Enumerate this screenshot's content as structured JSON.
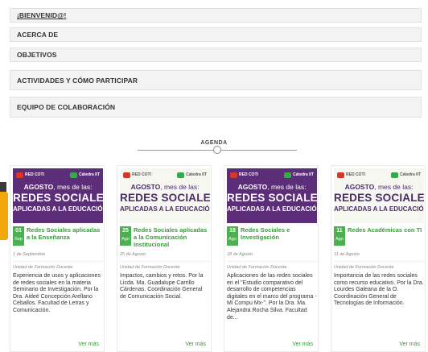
{
  "accordion": [
    {
      "label": "¡BIENVENID@!"
    },
    {
      "label": "ACERCA DE"
    },
    {
      "label": "OBJETIVOS"
    },
    {
      "label": "ACTIVIDADES Y CÓMO PARTICIPAR"
    },
    {
      "label": "EQUIPO DE COLABORACIÓN"
    }
  ],
  "agenda": {
    "title": "AGENDA"
  },
  "banner": {
    "logo_left": "RED COTI",
    "logo_right": "Cátedra IIT",
    "agosto": "AGOSTO",
    "mes": ", mes de las:",
    "redes": "REDES SOCIALES",
    "aplicadas": "APLICADAS A LA EDUCACIÓN"
  },
  "cards": [
    {
      "day": "01",
      "month": "Sep",
      "title": "Redes Sociales aplicadas a la Enseñanza",
      "date": "1 de Septiembre",
      "type": "Unidad de Formación Docente",
      "description": "Experiencia de usos y aplicaciones de redes sociales en la materia Seminario de Investigación. Por la Dra. Aideé Concepción Arellano Ceballos. Facultad de Letras y Comunicación.",
      "more": "Ver más",
      "style": "purple"
    },
    {
      "day": "25",
      "month": "Ago",
      "title": "Redes Sociales aplicadas a la Comunicación Institucional",
      "date": "25 de Agosto",
      "type": "Unidad de Formación Docente",
      "description": "Impactos, cambios y retos. Por la Licda. Ma. Guadalupe Carrillo Cárdenas. Coordinación General de Comunicación Social.",
      "more": "Ver más",
      "style": "light"
    },
    {
      "day": "18",
      "month": "Ago",
      "title": "Redes Sociales e Investigación",
      "date": "18 de Agosto",
      "type": "Unidad de Formación Docente",
      "description": "Aplicaciones de las redes sociales en el \"Estudio comparativo del desarrollo de competencias digitales en el marco del programa -Mi Compu Mx-\". Por la Dra. Ma. Alejandra Rocha Silva. Facultad de...",
      "more": "Ver más",
      "style": "purple"
    },
    {
      "day": "11",
      "month": "Ago",
      "title": "Redes Académicas con TI",
      "date": "11 de Agosto",
      "type": "Unidad de Formación Docente",
      "description": "Importancia de las redes sociales como recurso educativo. Por la Dra. Lourdes Galeana de la O. Coordinación General de Tecnologías de Información.",
      "more": "Ver más",
      "style": "light"
    }
  ],
  "colors": {
    "green": "#4caf50",
    "purple": "#5c2d79",
    "orange": "#f2a60a"
  }
}
